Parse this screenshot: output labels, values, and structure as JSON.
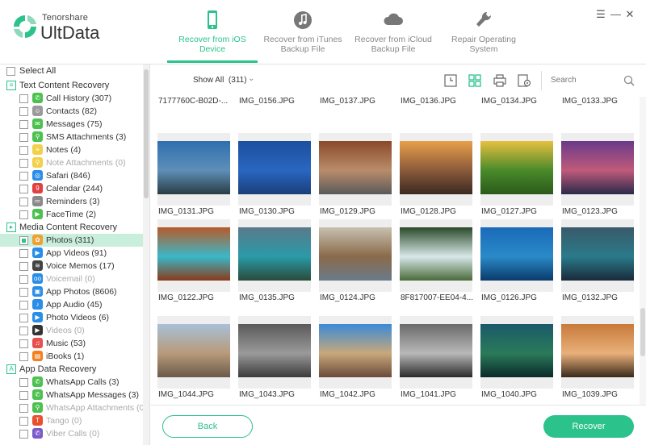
{
  "app": {
    "brand_top": "Tenorshare",
    "brand_name": "UltData"
  },
  "header": {
    "tabs": [
      {
        "line1": "Recover from iOS",
        "line2": "Device",
        "icon": "phone-icon",
        "active": true
      },
      {
        "line1": "Recover from iTunes",
        "line2": "Backup File",
        "icon": "music-icon",
        "active": false
      },
      {
        "line1": "Recover from iCloud",
        "line2": "Backup File",
        "icon": "cloud-icon",
        "active": false
      },
      {
        "line1": "Repair Operating",
        "line2": "System",
        "icon": "wrench-icon",
        "active": false
      }
    ],
    "window_controls": {
      "menu": "☰",
      "minimize": "—",
      "close": "✕"
    }
  },
  "sidebar": {
    "select_all": "Select All",
    "groups": [
      {
        "label": "Text Content Recovery",
        "items": [
          {
            "label": "Call History (307)",
            "icon": "call-history-icon",
            "color": "#4cc150",
            "glyph": "✆",
            "dim": false
          },
          {
            "label": "Contacts (82)",
            "icon": "contacts-icon",
            "color": "#9a9a9a",
            "glyph": "☺",
            "dim": false
          },
          {
            "label": "Messages (75)",
            "icon": "messages-icon",
            "color": "#4cc150",
            "glyph": "✉",
            "dim": false
          },
          {
            "label": "SMS Attachments (3)",
            "icon": "sms-attachments-icon",
            "color": "#4cc150",
            "glyph": "⚲",
            "dim": false
          },
          {
            "label": "Notes (4)",
            "icon": "notes-icon",
            "color": "#f2d04a",
            "glyph": "≡",
            "dim": false
          },
          {
            "label": "Note Attachments (0)",
            "icon": "note-attachments-icon",
            "color": "#f2d04a",
            "glyph": "⚲",
            "dim": true
          },
          {
            "label": "Safari (846)",
            "icon": "safari-icon",
            "color": "#2a8ee8",
            "glyph": "◎",
            "dim": false
          },
          {
            "label": "Calendar (244)",
            "icon": "calendar-icon",
            "color": "#e04040",
            "glyph": "9",
            "dim": false
          },
          {
            "label": "Reminders (3)",
            "icon": "reminders-icon",
            "color": "#8a8a8a",
            "glyph": "≔",
            "dim": false
          },
          {
            "label": "FaceTime (2)",
            "icon": "facetime-icon",
            "color": "#4cc150",
            "glyph": "▶",
            "dim": false
          }
        ]
      },
      {
        "label": "Media Content Recovery",
        "items": [
          {
            "label": "Photos (311)",
            "icon": "photos-icon",
            "color": "#f0a030",
            "glyph": "✿",
            "dim": false,
            "selected": true
          },
          {
            "label": "App Videos (91)",
            "icon": "app-videos-icon",
            "color": "#2a8ee8",
            "glyph": "▶",
            "dim": false
          },
          {
            "label": "Voice Memos (17)",
            "icon": "voice-memos-icon",
            "color": "#444444",
            "glyph": "≋",
            "dim": false
          },
          {
            "label": "Voicemail (0)",
            "icon": "voicemail-icon",
            "color": "#2a8ee8",
            "glyph": "oo",
            "dim": true
          },
          {
            "label": "App Photos (8606)",
            "icon": "app-photos-icon",
            "color": "#2a8ee8",
            "glyph": "▣",
            "dim": false
          },
          {
            "label": "App Audio (45)",
            "icon": "app-audio-icon",
            "color": "#2a8ee8",
            "glyph": "♪",
            "dim": false
          },
          {
            "label": "Photo Videos (6)",
            "icon": "photo-videos-icon",
            "color": "#2a8ee8",
            "glyph": "▶",
            "dim": false
          },
          {
            "label": "Videos (0)",
            "icon": "videos-icon",
            "color": "#333333",
            "glyph": "▶",
            "dim": true
          },
          {
            "label": "Music (53)",
            "icon": "music-item-icon",
            "color": "#e85050",
            "glyph": "♫",
            "dim": false
          },
          {
            "label": "iBooks (1)",
            "icon": "ibooks-icon",
            "color": "#f08020",
            "glyph": "▤",
            "dim": false
          }
        ]
      },
      {
        "label": "App Data Recovery",
        "items": [
          {
            "label": "WhatsApp Calls (3)",
            "icon": "whatsapp-calls-icon",
            "color": "#4cc150",
            "glyph": "✆",
            "dim": false
          },
          {
            "label": "WhatsApp Messages (3)",
            "icon": "whatsapp-messages-icon",
            "color": "#4cc150",
            "glyph": "✆",
            "dim": false
          },
          {
            "label": "WhatsApp Attachments (0)",
            "icon": "whatsapp-attachments-icon",
            "color": "#4cc150",
            "glyph": "⚲",
            "dim": true
          },
          {
            "label": "Tango (0)",
            "icon": "tango-icon",
            "color": "#e85030",
            "glyph": "T",
            "dim": true
          },
          {
            "label": "Viber Calls (0)",
            "icon": "viber-calls-icon",
            "color": "#7a5ac8",
            "glyph": "✆",
            "dim": true
          }
        ]
      }
    ]
  },
  "toolbar": {
    "show_all_label": "Show All",
    "show_all_count": "(311)",
    "search_placeholder": "Search"
  },
  "grid": {
    "rows": [
      {
        "partial": true,
        "items": [
          "7177760C-B02D-...",
          "IMG_0156.JPG",
          "IMG_0137.JPG",
          "IMG_0136.JPG",
          "IMG_0134.JPG",
          "IMG_0133.JPG"
        ]
      },
      {
        "items": [
          {
            "caption": "IMG_0131.JPG",
            "colors": [
              "#2f6fb0",
              "#5d8fb8",
              "#2a3c44"
            ]
          },
          {
            "caption": "IMG_0130.JPG",
            "colors": [
              "#1c4f9e",
              "#2a66c0",
              "#1a3f7a"
            ]
          },
          {
            "caption": "IMG_0129.JPG",
            "colors": [
              "#8a4a2a",
              "#b98c6a",
              "#5a5a5a"
            ]
          },
          {
            "caption": "IMG_0128.JPG",
            "colors": [
              "#e8a04a",
              "#8a5a3a",
              "#3a2a22"
            ]
          },
          {
            "caption": "IMG_0127.JPG",
            "colors": [
              "#e8c040",
              "#4a8a2a",
              "#2a5a1a"
            ]
          },
          {
            "caption": "IMG_0123.JPG",
            "colors": [
              "#6a3a8a",
              "#c05a7a",
              "#2a2a4a"
            ]
          }
        ]
      },
      {
        "items": [
          {
            "caption": "IMG_0122.JPG",
            "colors": [
              "#b85a2a",
              "#3ab8c8",
              "#8a3a1a"
            ]
          },
          {
            "caption": "IMG_0135.JPG",
            "colors": [
              "#5a7a8a",
              "#2a9aa8",
              "#2a4a3a"
            ]
          },
          {
            "caption": "IMG_0124.JPG",
            "colors": [
              "#c8c0b0",
              "#8a6a4a",
              "#6a7a8a"
            ]
          },
          {
            "caption": "8F817007-EE04-4...",
            "colors": [
              "#2a4a2a",
              "#d8e8e8",
              "#4a6a3a"
            ]
          },
          {
            "caption": "IMG_0126.JPG",
            "colors": [
              "#1a6ab8",
              "#2a8ac8",
              "#0a3a6a"
            ]
          },
          {
            "caption": "IMG_0132.JPG",
            "colors": [
              "#3a5a6a",
              "#2a7a8a",
              "#1a2a3a"
            ]
          }
        ]
      },
      {
        "items": [
          {
            "caption": "IMG_1044.JPG",
            "colors": [
              "#a8c0d8",
              "#b89a7a",
              "#6a5a4a"
            ]
          },
          {
            "caption": "IMG_1043.JPG",
            "colors": [
              "#5a5a5a",
              "#9a9a9a",
              "#3a3a3a"
            ]
          },
          {
            "caption": "IMG_1042.JPG",
            "colors": [
              "#3a8ad8",
              "#c8a87a",
              "#6a4a3a"
            ]
          },
          {
            "caption": "IMG_1041.JPG",
            "colors": [
              "#6a6a6a",
              "#b8b8b8",
              "#2a2a2a"
            ]
          },
          {
            "caption": "IMG_1040.JPG",
            "colors": [
              "#1a5a6a",
              "#2a7a5a",
              "#0a2a2a"
            ]
          },
          {
            "caption": "IMG_1039.JPG",
            "colors": [
              "#c87a3a",
              "#e8b07a",
              "#3a2a1a"
            ]
          }
        ]
      }
    ]
  },
  "footer": {
    "back_label": "Back",
    "recover_label": "Recover"
  },
  "colors": {
    "accent": "#2bc28b",
    "selection": "#c9eedc"
  }
}
